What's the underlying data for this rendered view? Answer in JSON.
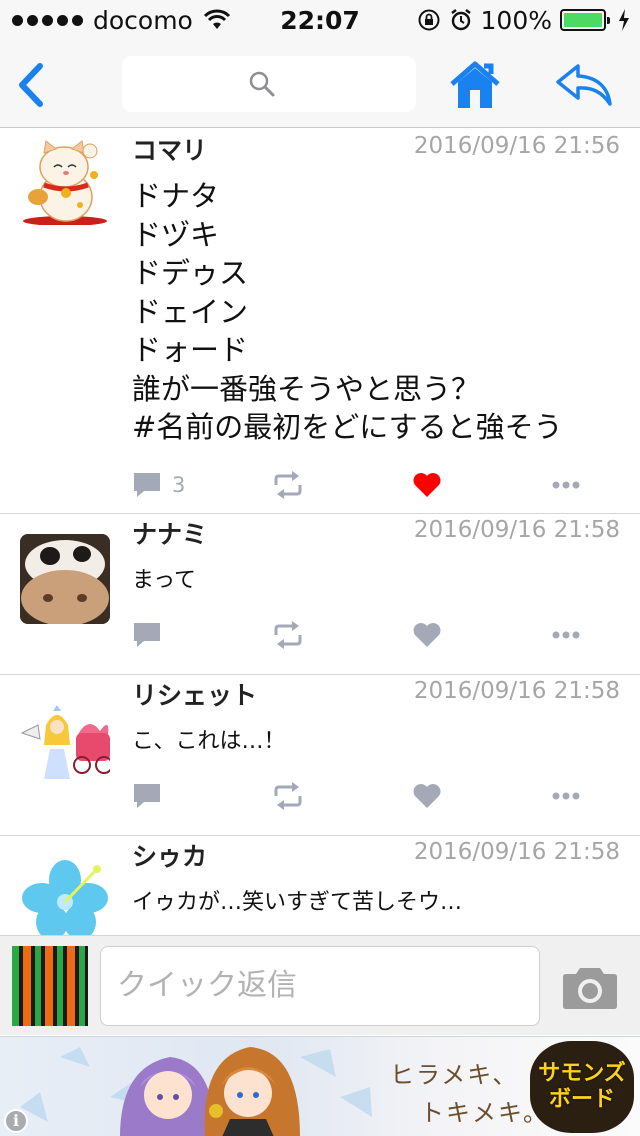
{
  "status_bar": {
    "carrier": "docomo",
    "time": "22:07",
    "battery": "100%"
  },
  "nav": {
    "back_icon": "chevron-left-icon",
    "search_icon": "search-icon",
    "home_icon": "home-icon",
    "reply_icon": "reply-arrow-icon",
    "accent": "#1a82f0"
  },
  "tweets": [
    {
      "user": "コマリ",
      "date": "2016/09/16 21:56",
      "text": "ドナタ\nドヅキ\nドデゥス\nドェイン\nドォード\n誰が一番強そうやと思う？\n#名前の最初をどにすると強そう",
      "reply_count": "3",
      "liked": true
    },
    {
      "user": "ナナミ",
      "date": "2016/09/16 21:58",
      "text": "まって",
      "reply_count": "",
      "liked": false
    },
    {
      "user": "リシェット",
      "date": "2016/09/16 21:58",
      "text": "こ、これは…！",
      "reply_count": "",
      "liked": false
    },
    {
      "user": "シゥカ",
      "date": "2016/09/16 21:58",
      "text": "イゥカが…笑いすぎて苦しそウ…",
      "reply_count": "",
      "liked": false
    }
  ],
  "quick_reply": {
    "placeholder": "クイック返信",
    "camera_icon": "camera-icon"
  },
  "banner": {
    "tagline_1": "ヒラメキ、",
    "tagline_2": "トキメキ。",
    "logo_line_1": "サモンズ",
    "logo_line_2": "ボード",
    "info_icon": "info-icon"
  },
  "colors": {
    "like_active": "#ff0000",
    "action_gray": "#a3a9b6",
    "date_gray": "#a6a6a6"
  }
}
